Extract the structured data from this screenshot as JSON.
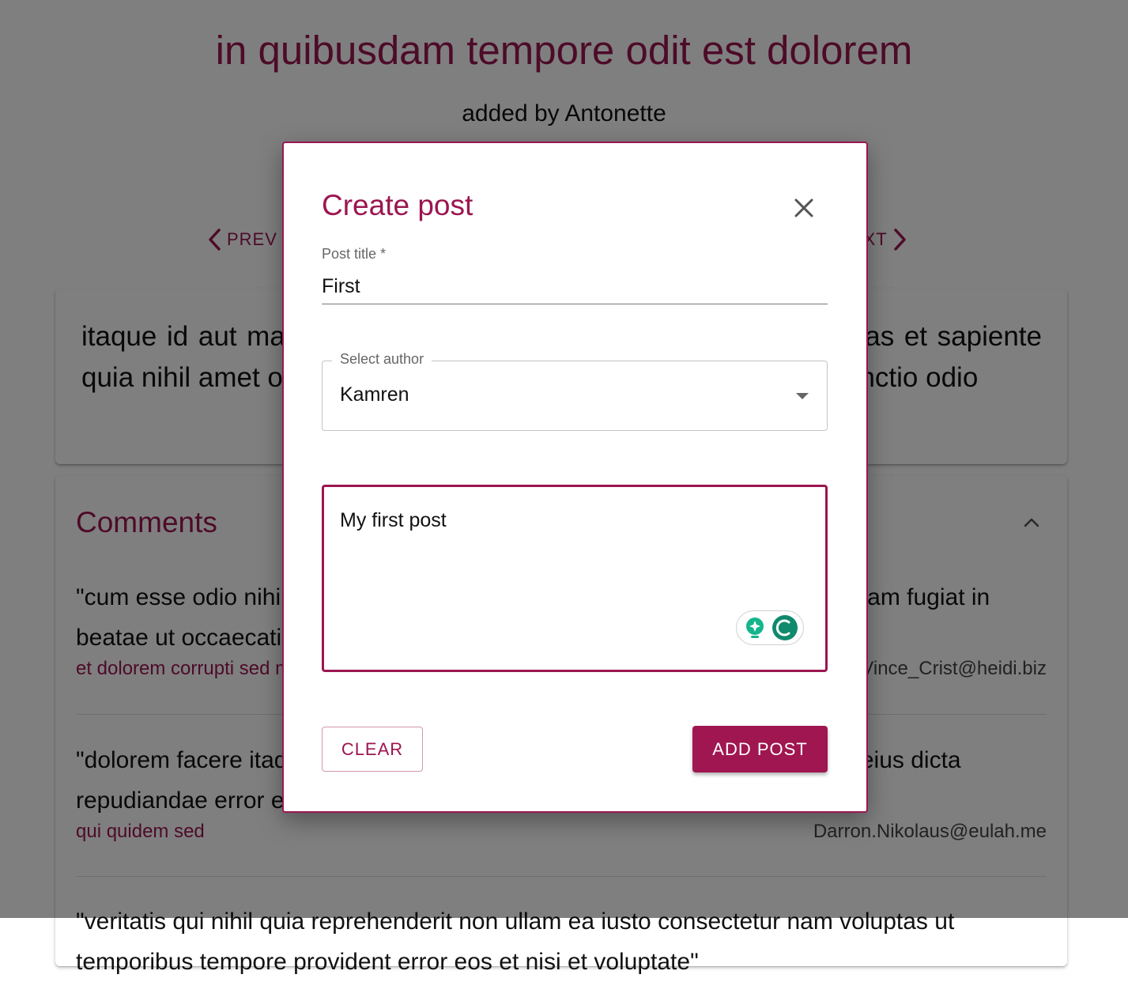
{
  "post": {
    "title": "in quibusdam tempore odit est dolorem",
    "author_line": "added by Antonette",
    "body": "itaque id aut magnam praesentium quia et ea odit et ea voluptas et sapiente quia nihil amet occaecati quia id voluptatem incidunt ea est distinctio odio"
  },
  "pager": {
    "prev_label": "PREV",
    "next_label": "NEXT"
  },
  "comments": {
    "title": "Comments",
    "items": [
      {
        "body": "\"cum esse odio nihil reiciendis illum quaerat est facere quia occaecati sit totam fugiat in beatae ut occaecati unde vitae nihil quidem consequatur\"",
        "name": "et dolorem corrupti sed molestias",
        "email": "Vince_Crist@heidi.biz"
      },
      {
        "body": "\"dolorem facere itaque fuga odit autem perferendis quisquam quis corrupti eius dicta repudiandae error esse itaque aut corrupti sint consequatur aliquid\"",
        "name": "qui quidem sed",
        "email": "Darron.Nikolaus@eulah.me"
      },
      {
        "body": "\"veritatis qui nihil quia reprehenderit non ullam ea iusto consectetur nam voluptas ut temporibus tempore provident error eos et nisi et voluptate\"",
        "name": "",
        "email": ""
      }
    ]
  },
  "dialog": {
    "title": "Create post",
    "title_field": {
      "label": "Post title *",
      "value": "First"
    },
    "author_select": {
      "label": "Select author",
      "value": "Kamren"
    },
    "content": {
      "value": "My first post"
    },
    "clear_label": "CLEAR",
    "add_label": "ADD POST"
  },
  "colors": {
    "accent": "#9b1650",
    "button": "#a01650",
    "overlay": "rgba(0,0,0,0.5)",
    "grammarly": "#15a37d"
  },
  "icons": {
    "prev": "chevron-left-icon",
    "next": "chevron-right-icon",
    "collapse": "chevron-up-icon",
    "close": "close-icon",
    "dropdown": "caret-down-icon",
    "grammar": [
      "lightbulb-icon",
      "grammarly-icon"
    ]
  }
}
